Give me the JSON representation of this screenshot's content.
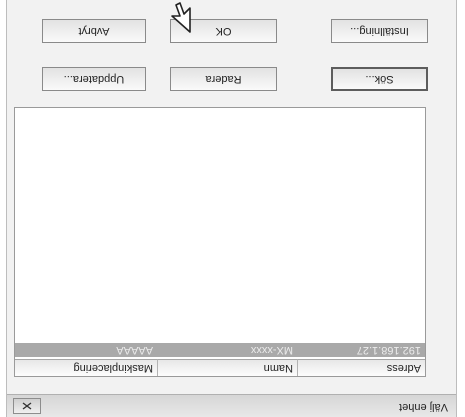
{
  "window": {
    "title": "Välj enhet",
    "close_icon": "close-icon"
  },
  "list": {
    "columns": [
      "Adress",
      "Namn",
      "Maskinplacering"
    ],
    "rows": [
      {
        "adress": "192.168.1.27",
        "namn": "MX-xxxx",
        "maskinplacering": "AAAAA"
      }
    ]
  },
  "buttons": {
    "sok": "Sök...",
    "radera": "Radera",
    "uppdatera": "Uppdatera...",
    "installning": "Inställning...",
    "ok": "OK",
    "avbryt": "Avbryt"
  },
  "icons": {
    "pointer": "mouse-pointer-icon"
  }
}
